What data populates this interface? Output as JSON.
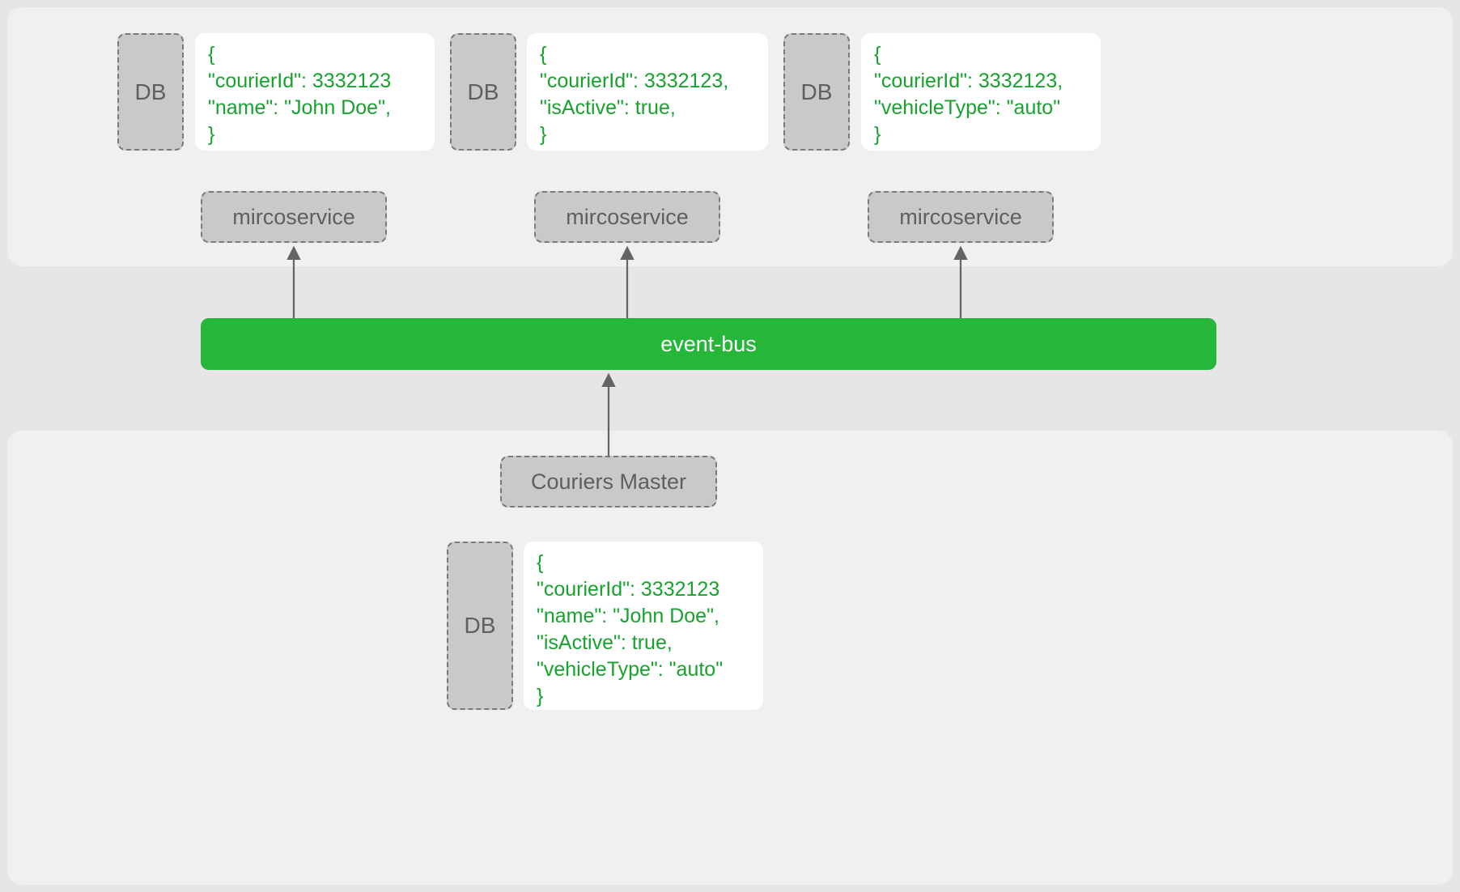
{
  "labels": {
    "db": "DB",
    "microservice": "mircoservice",
    "event_bus": "event-bus",
    "couriers_master": "Couriers Master"
  },
  "top": {
    "services": [
      {
        "db_label": "DB",
        "ms_label": "mircoservice",
        "code": "{\n\"courierId\": 3332123\n\"name\": \"John Doe\",\n}"
      },
      {
        "db_label": "DB",
        "ms_label": "mircoservice",
        "code": "{\n\"courierId\": 3332123,\n\"isActive\": true,\n}"
      },
      {
        "db_label": "DB",
        "ms_label": "mircoservice",
        "code": "{\n\"courierId\": 3332123,\n\"vehicleType\": \"auto\"\n}"
      }
    ]
  },
  "bottom": {
    "master_label": "Couriers Master",
    "db_label": "DB",
    "code": "{\n\"courierId\": 3332123\n\"name\": \"John Doe\",\n\"isActive\": true,\n\"vehicleType\": \"auto\"\n}"
  },
  "colors": {
    "panel_bg": "#f0f0f0",
    "page_bg": "#e6e6e6",
    "box_bg": "#c9c9c9",
    "box_border": "#7a7a7a",
    "code_text": "#17a22e",
    "event_bus_bg": "#25b63a",
    "arrow": "#646464"
  }
}
